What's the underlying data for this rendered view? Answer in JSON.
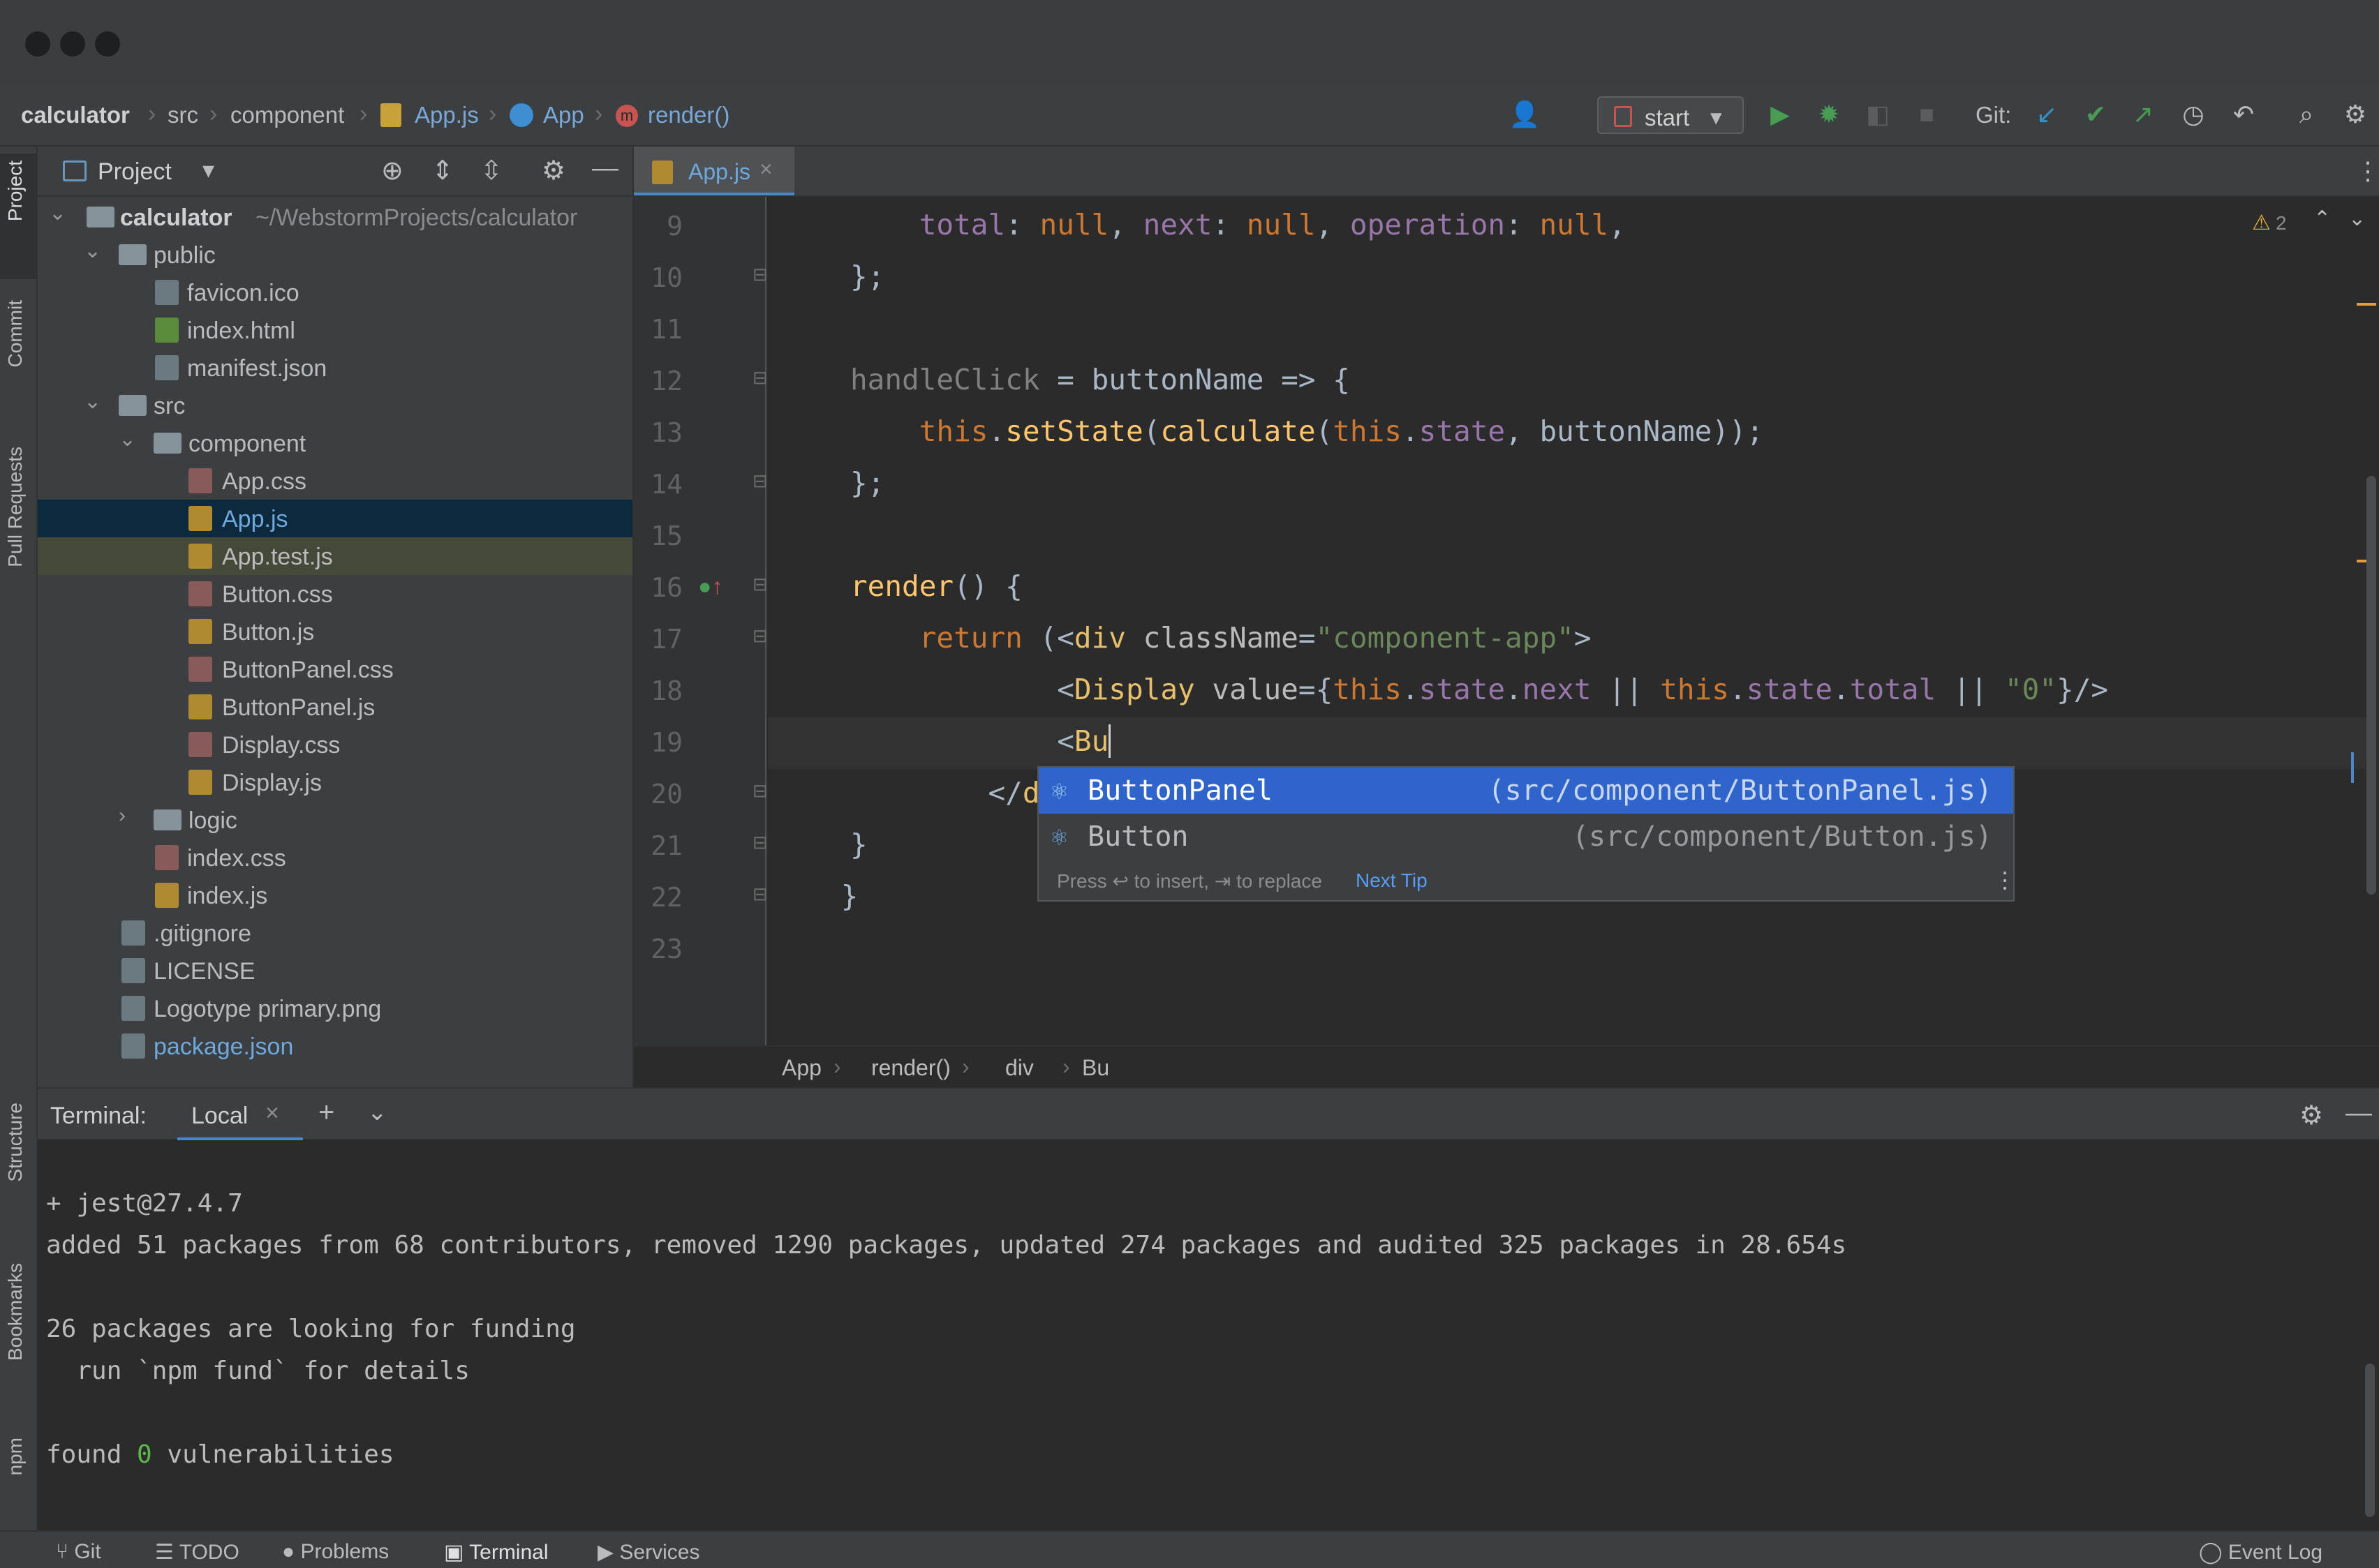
{
  "navbar": {
    "crumbs": [
      "calculator",
      "src",
      "component",
      "App.js",
      "App",
      "render()"
    ],
    "run_config": "start",
    "git_label": "Git:"
  },
  "left_strip": {
    "tabs": [
      "Project",
      "Commit",
      "Pull Requests",
      "Structure",
      "Bookmarks",
      "npm"
    ]
  },
  "project": {
    "title": "Project",
    "tree": [
      {
        "label": "calculator",
        "extra": "~/WebstormProjects/calculator"
      },
      {
        "label": "public"
      },
      {
        "label": "favicon.ico"
      },
      {
        "label": "index.html"
      },
      {
        "label": "manifest.json"
      },
      {
        "label": "src"
      },
      {
        "label": "component"
      },
      {
        "label": "App.css"
      },
      {
        "label": "App.js"
      },
      {
        "label": "App.test.js"
      },
      {
        "label": "Button.css"
      },
      {
        "label": "Button.js"
      },
      {
        "label": "ButtonPanel.css"
      },
      {
        "label": "ButtonPanel.js"
      },
      {
        "label": "Display.css"
      },
      {
        "label": "Display.js"
      },
      {
        "label": "logic"
      },
      {
        "label": "index.css"
      },
      {
        "label": "index.js"
      },
      {
        "label": ".gitignore"
      },
      {
        "label": "LICENSE"
      },
      {
        "label": "Logotype primary.png"
      },
      {
        "label": "package.json"
      }
    ]
  },
  "editor": {
    "tab": "App.js",
    "warnings": "2",
    "line_numbers": [
      "9",
      "10",
      "11",
      "12",
      "13",
      "14",
      "15",
      "16",
      "17",
      "18",
      "19",
      "20",
      "21",
      "22",
      "23"
    ],
    "breadcrumbs": [
      "App",
      "render()",
      "div",
      "Bu"
    ]
  },
  "completion": {
    "items": [
      {
        "name": "ButtonPanel",
        "path": "(src/component/ButtonPanel.js)"
      },
      {
        "name": "Button",
        "path": "(src/component/Button.js)"
      }
    ],
    "hint": "Press ↩ to insert, ⇥ to replace",
    "next_tip": "Next Tip"
  },
  "terminal": {
    "label": "Terminal:",
    "tab": "Local",
    "lines": [
      "+ jest@27.4.7",
      "added 51 packages from 68 contributors, removed 1290 packages, updated 274 packages and audited 325 packages in 28.654s",
      "",
      "26 packages are looking for funding",
      "  run `npm fund` for details",
      ""
    ],
    "found_prefix": "found ",
    "found_count": "0",
    "found_suffix": " vulnerabilities"
  },
  "statusbar": {
    "items": [
      "Git",
      "TODO",
      "Problems",
      "Terminal",
      "Services"
    ],
    "event_log": "Event Log"
  },
  "colors": {
    "selection": "#0d293e",
    "accent": "#2f65ca",
    "run_green": "#499c54"
  }
}
